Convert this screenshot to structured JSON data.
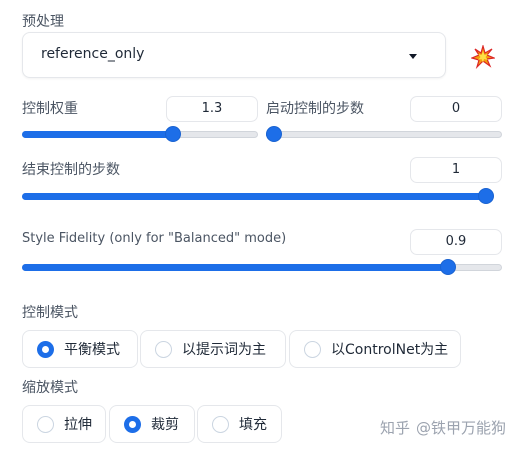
{
  "preprocessor": {
    "label": "预处理",
    "selected": "reference_only",
    "run_icon": "explosion-icon"
  },
  "control_weight": {
    "label": "控制权重",
    "value": "1.3",
    "min": 0,
    "max": 2,
    "level": 1.3
  },
  "start_step": {
    "label": "启动控制的步数",
    "value": "0",
    "min": 0,
    "max": 1,
    "level": 0
  },
  "end_step": {
    "label": "结束控制的步数",
    "value": "1",
    "min": 0,
    "max": 1,
    "level": 1
  },
  "style_fidelity": {
    "label": "Style Fidelity (only for \"Balanced\" mode)",
    "value": "0.9",
    "min": 0,
    "max": 1,
    "level": 0.9
  },
  "control_mode": {
    "label": "控制模式",
    "options": [
      "平衡模式",
      "以提示词为主",
      "以ControlNet为主"
    ],
    "selected_index": 0
  },
  "resize_mode": {
    "label": "缩放模式",
    "options": [
      "拉伸",
      "裁剪",
      "填充"
    ],
    "selected_index": 1
  },
  "watermark": {
    "site": "知乎",
    "author": "@铁甲万能狗"
  },
  "colors": {
    "accent": "#1d6ee8",
    "border": "#e5e7eb",
    "label": "#4b5563"
  }
}
